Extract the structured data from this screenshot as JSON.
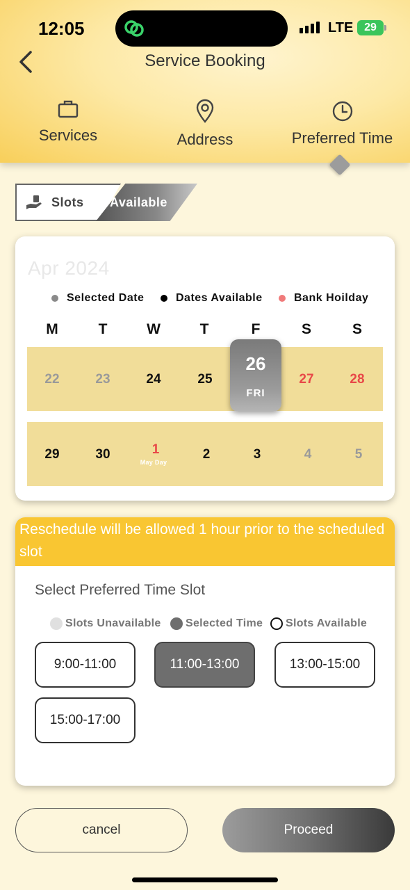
{
  "status_bar": {
    "time": "12:05",
    "network": "LTE",
    "battery": "29"
  },
  "header": {
    "title": "Service Booking"
  },
  "steps": [
    {
      "label": "Services",
      "icon": "briefcase-icon"
    },
    {
      "label": "Address",
      "icon": "location-pin-icon"
    },
    {
      "label": "Preferred Time",
      "icon": "clock-icon"
    }
  ],
  "slots_tag": {
    "left": "Slots",
    "right": "Available"
  },
  "calendar": {
    "month": "Apr 2024",
    "legend": [
      {
        "label": "Selected Date",
        "color": "#8a8a8a"
      },
      {
        "label": "Dates Available",
        "color": "#000000"
      },
      {
        "label": "Bank Hoilday",
        "color": "#f07a7a"
      }
    ],
    "weekdays": [
      "M",
      "T",
      "W",
      "T",
      "F",
      "S",
      "S"
    ],
    "week1": [
      {
        "day": "22",
        "state": "unavailable"
      },
      {
        "day": "23",
        "state": "unavailable"
      },
      {
        "day": "24",
        "state": "available"
      },
      {
        "day": "25",
        "state": "available"
      },
      {
        "day": "26",
        "state": "selected",
        "sub": "FRI"
      },
      {
        "day": "27",
        "state": "holiday"
      },
      {
        "day": "28",
        "state": "holiday"
      }
    ],
    "week2": [
      {
        "day": "29",
        "state": "available"
      },
      {
        "day": "30",
        "state": "available"
      },
      {
        "day": "1",
        "state": "holiday",
        "sub": "May Day"
      },
      {
        "day": "2",
        "state": "available"
      },
      {
        "day": "3",
        "state": "available"
      },
      {
        "day": "4",
        "state": "unavailable"
      },
      {
        "day": "5",
        "state": "unavailable"
      }
    ]
  },
  "time_section": {
    "notice": "Reschedule will be allowed 1 hour prior to the scheduled slot",
    "title": "Select Preferred Time Slot",
    "legend": [
      {
        "label": "Slots Unavailable",
        "color": "#e0e0e0"
      },
      {
        "label": "Selected Time",
        "color": "#6e6e6e"
      },
      {
        "label": "Slots Available",
        "color": "#ffffff"
      }
    ],
    "slots": [
      {
        "label": "9:00-11:00",
        "selected": false
      },
      {
        "label": "11:00-13:00",
        "selected": true
      },
      {
        "label": "13:00-15:00",
        "selected": false
      },
      {
        "label": "15:00-17:00",
        "selected": false
      }
    ]
  },
  "actions": {
    "cancel": "cancel",
    "proceed": "Proceed"
  }
}
